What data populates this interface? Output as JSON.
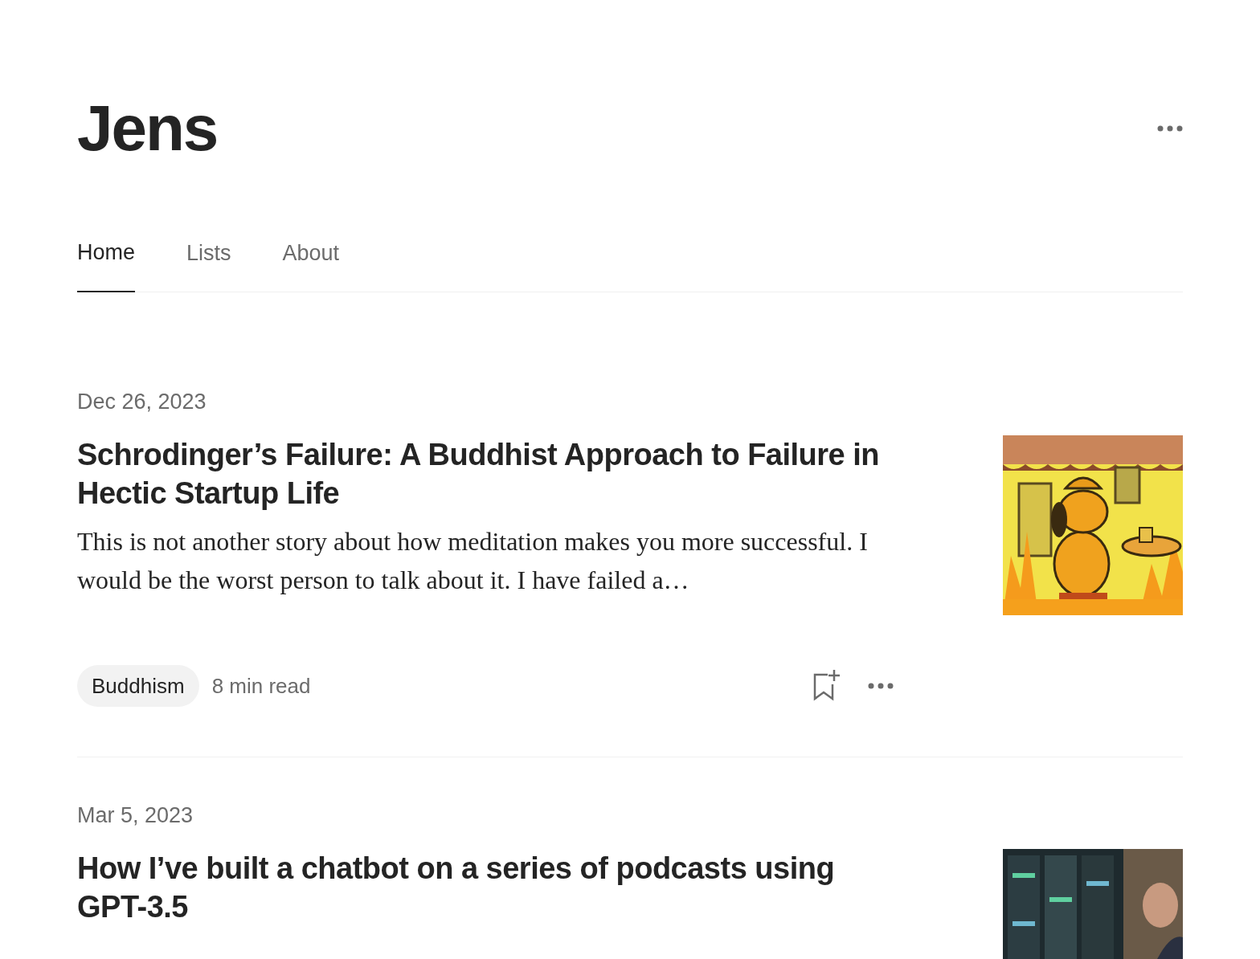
{
  "profile": {
    "name": "Jens"
  },
  "tabs": [
    {
      "label": "Home",
      "selected": true
    },
    {
      "label": "Lists",
      "selected": false
    },
    {
      "label": "About",
      "selected": false
    }
  ],
  "articles": [
    {
      "date": "Dec 26, 2023",
      "title": "Schrodinger’s Failure: A Buddhist Approach to Failure in Hectic Startup Life",
      "excerpt": "This is not another story about how meditation makes you more successful. I would be the worst person to talk about it. I have failed a…",
      "tag": "Buddhism",
      "read_time": "8 min read"
    },
    {
      "date": "Mar 5, 2023",
      "title": "How I’ve built a chatbot on a series of podcasts using GPT-3.5"
    }
  ]
}
